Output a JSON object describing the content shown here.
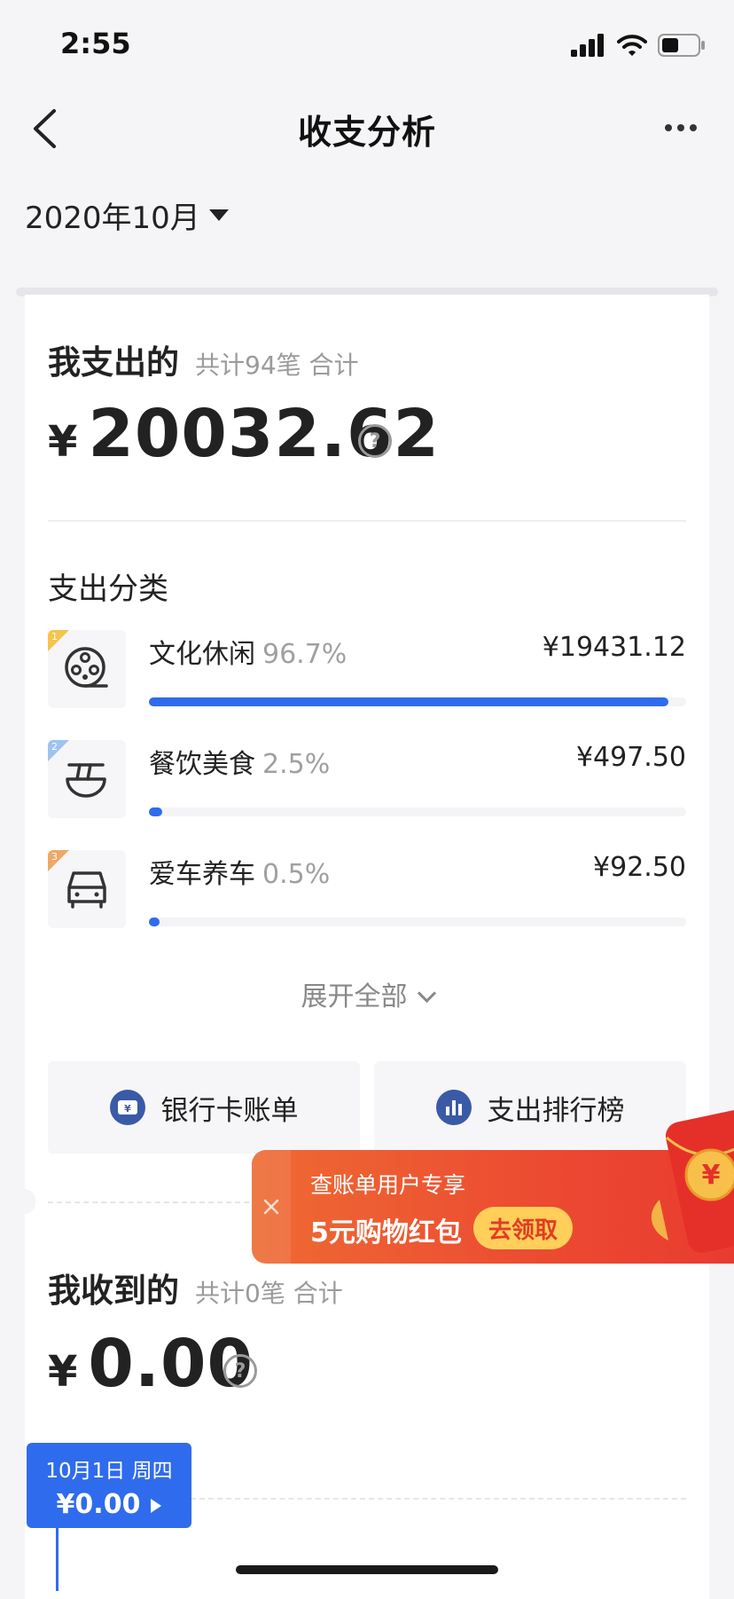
{
  "status": {
    "time": "2:55"
  },
  "nav": {
    "title": "收支分析"
  },
  "month": {
    "label": "2020年10月"
  },
  "expense": {
    "title": "我支出的",
    "summary": "共计94笔 合计",
    "currency": "¥",
    "amount": "20032.62",
    "help": "?"
  },
  "categories": {
    "title": "支出分类",
    "items": [
      {
        "rank": "1",
        "name": "文化休闲",
        "pct": "96.7%",
        "amount": "¥19431.12",
        "icon": "film-reel-icon",
        "share": 0.967,
        "rank_color": "#f5c44a"
      },
      {
        "rank": "2",
        "name": "餐饮美食",
        "pct": "2.5%",
        "amount": "¥497.50",
        "icon": "noodle-bowl-icon",
        "share": 0.025,
        "rank_color": "#9fc3f0"
      },
      {
        "rank": "3",
        "name": "爱车养车",
        "pct": "0.5%",
        "amount": "¥92.50",
        "icon": "car-icon",
        "share": 0.005,
        "rank_color": "#f0a867"
      }
    ],
    "expand_label": "展开全部"
  },
  "quick": {
    "bank_label": "银行卡账单",
    "ranking_label": "支出排行榜"
  },
  "promo": {
    "line1": "查账单用户专享",
    "line2": "5元购物红包",
    "cta": "去领取",
    "coin": "¥"
  },
  "income": {
    "title": "我收到的",
    "summary": "共计0笔 合计",
    "currency": "¥",
    "amount": "0.00",
    "help": "?"
  },
  "chart_tooltip": {
    "date": "10月1日 周四",
    "value": "¥0.00"
  },
  "colors": {
    "accent": "#2f6bed",
    "promo": "#ec4a31",
    "promo_button": "#ffcf5a"
  }
}
